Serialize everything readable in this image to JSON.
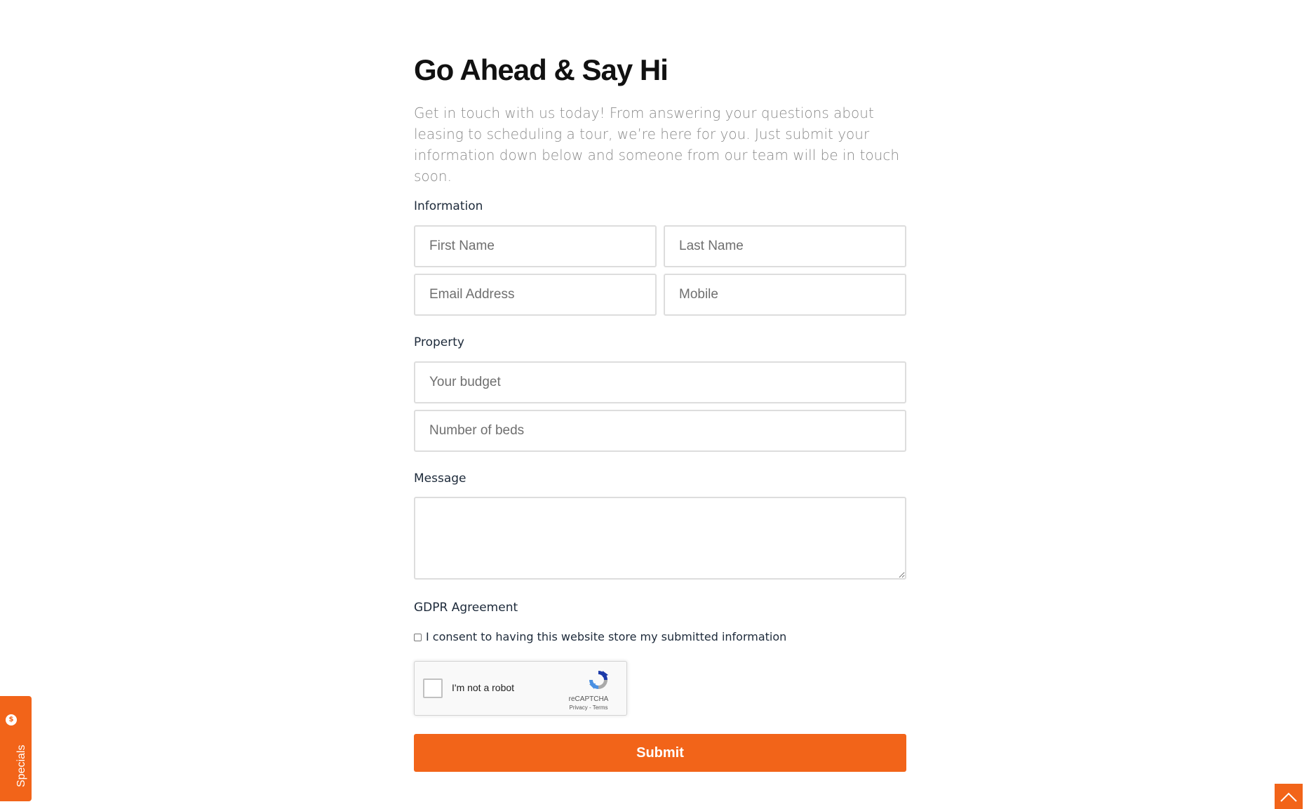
{
  "header": {
    "title": "Go Ahead & Say Hi",
    "intro": "Get in touch with us today! From answering your questions about leasing to scheduling a tour, we’re here for you. Just submit your information down below and someone from our team will be in touch soon."
  },
  "sections": {
    "information": "Information",
    "property": "Property",
    "message": "Message",
    "gdpr": "GDPR Agreement"
  },
  "fields": {
    "first_name": {
      "placeholder": "First Name",
      "value": ""
    },
    "last_name": {
      "placeholder": "Last Name",
      "value": ""
    },
    "email": {
      "placeholder": "Email Address",
      "value": ""
    },
    "mobile": {
      "placeholder": "Mobile",
      "value": ""
    },
    "budget": {
      "placeholder": "Your budget",
      "value": ""
    },
    "beds": {
      "placeholder": "Number of beds",
      "value": ""
    },
    "message": {
      "value": ""
    }
  },
  "consent": {
    "label": "I consent to having this website store my submitted information",
    "checked": false
  },
  "recaptcha": {
    "label": "I'm not a robot",
    "brand": "reCAPTCHA",
    "links": "Privacy - Terms",
    "icon": "recaptcha-logo-icon"
  },
  "submit": {
    "label": "Submit"
  },
  "specials_tab": {
    "label": "Specials",
    "icon": "dollar-icon",
    "icon_glyph": "$"
  },
  "scroll_top": {
    "icon": "chevron-up-icon"
  },
  "colors": {
    "accent": "#f26419",
    "title": "#111111",
    "body_text": "#8a8a8a",
    "label_text": "#1d2a3a",
    "field_border": "#dddddd"
  }
}
